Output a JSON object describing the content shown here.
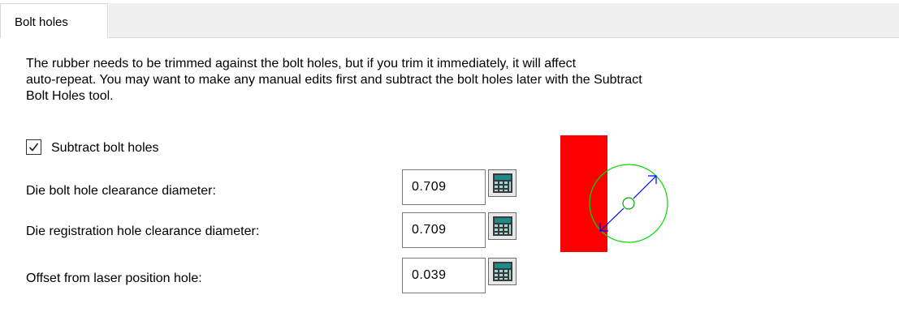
{
  "tabs": [
    {
      "label": "Bolt holes",
      "active": true
    }
  ],
  "description": {
    "line1": "The rubber needs to be trimmed against the bolt holes, but if you trim it immediately, it will affect",
    "line2": "auto-repeat. You may want to make any manual edits first and subtract the bolt holes later with the Subtract",
    "line3": "Bolt Holes tool."
  },
  "subtract_checkbox": {
    "label": "Subtract bolt holes",
    "checked": true
  },
  "fields": [
    {
      "label": "Die bolt hole clearance diameter:",
      "value": "0.709"
    },
    {
      "label": "Die registration hole clearance diameter:",
      "value": "0.709"
    },
    {
      "label": "Offset from laser position hole:",
      "value": "0.039"
    }
  ],
  "icons": {
    "calculator": "calculator-icon",
    "checkmark": "checkmark-icon"
  },
  "colors": {
    "rubber": "#ff0000",
    "hole_circle": "#00dd00",
    "dimension_arrow": "#0000ff",
    "calculator_screen": "#1f8a8a"
  }
}
